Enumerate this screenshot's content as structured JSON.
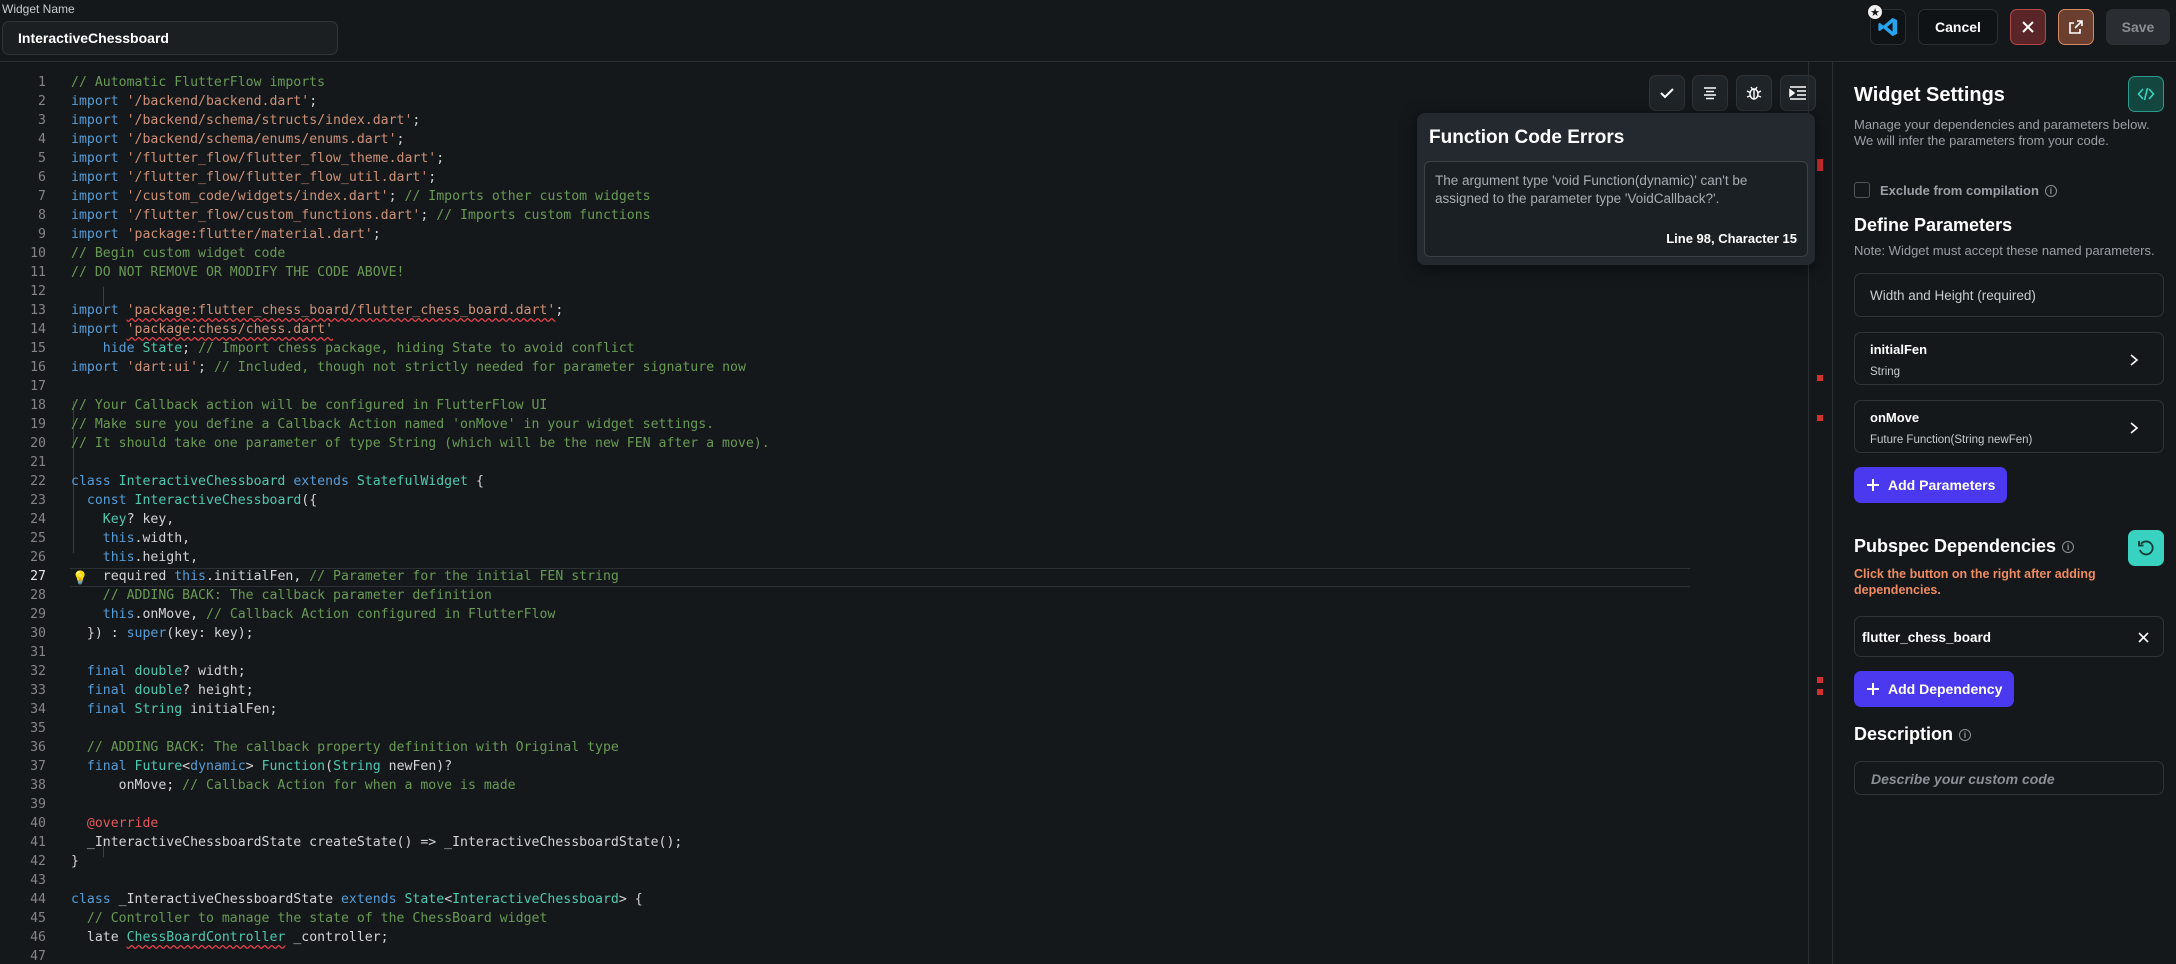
{
  "header": {
    "widget_name_label": "Widget Name",
    "widget_name_value": "InteractiveChessboard",
    "cancel_label": "Cancel",
    "save_label": "Save"
  },
  "editor": {
    "current_line": 27,
    "lines": [
      [
        [
          "c",
          "// Automatic FlutterFlow imports"
        ]
      ],
      [
        [
          "k",
          "import "
        ],
        [
          "s",
          "'/backend/backend.dart'"
        ],
        [
          "p",
          ";"
        ]
      ],
      [
        [
          "k",
          "import "
        ],
        [
          "s",
          "'/backend/schema/structs/index.dart'"
        ],
        [
          "p",
          ";"
        ]
      ],
      [
        [
          "k",
          "import "
        ],
        [
          "s",
          "'/backend/schema/enums/enums.dart'"
        ],
        [
          "p",
          ";"
        ]
      ],
      [
        [
          "k",
          "import "
        ],
        [
          "s",
          "'/flutter_flow/flutter_flow_theme.dart'"
        ],
        [
          "p",
          ";"
        ]
      ],
      [
        [
          "k",
          "import "
        ],
        [
          "s",
          "'/flutter_flow/flutter_flow_util.dart'"
        ],
        [
          "p",
          ";"
        ]
      ],
      [
        [
          "k",
          "import "
        ],
        [
          "s",
          "'/custom_code/widgets/index.dart'"
        ],
        [
          "p",
          "; "
        ],
        [
          "c",
          "// Imports other custom widgets"
        ]
      ],
      [
        [
          "k",
          "import "
        ],
        [
          "s",
          "'/flutter_flow/custom_functions.dart'"
        ],
        [
          "p",
          "; "
        ],
        [
          "c",
          "// Imports custom functions"
        ]
      ],
      [
        [
          "k",
          "import "
        ],
        [
          "s",
          "'package:flutter/material.dart'"
        ],
        [
          "p",
          ";"
        ]
      ],
      [
        [
          "c",
          "// Begin custom widget code"
        ]
      ],
      [
        [
          "c",
          "// DO NOT REMOVE OR MODIFY THE CODE ABOVE!"
        ]
      ],
      [],
      [
        [
          "k",
          "import "
        ],
        [
          "s sq",
          "'package:flutter_chess_board/flutter_chess_board.dart'"
        ],
        [
          "p",
          ";"
        ]
      ],
      [
        [
          "k",
          "import "
        ],
        [
          "s sq",
          "'package:chess/chess.dart'"
        ]
      ],
      [
        [
          "p",
          "    "
        ],
        [
          "k",
          "hide "
        ],
        [
          "t",
          "State"
        ],
        [
          "p",
          "; "
        ],
        [
          "c",
          "// Import chess package, hiding State to avoid conflict"
        ]
      ],
      [
        [
          "k",
          "import "
        ],
        [
          "s",
          "'dart:ui'"
        ],
        [
          "p",
          "; "
        ],
        [
          "c",
          "// Included, though not strictly needed for parameter signature now"
        ]
      ],
      [],
      [
        [
          "c",
          "// Your Callback action will be configured in FlutterFlow UI"
        ]
      ],
      [
        [
          "c",
          "// Make sure you define a Callback Action named 'onMove' in your widget settings."
        ]
      ],
      [
        [
          "c",
          "// It should take one parameter of type String (which will be the new FEN after a move)."
        ]
      ],
      [],
      [
        [
          "k",
          "class "
        ],
        [
          "t",
          "InteractiveChessboard "
        ],
        [
          "k",
          "extends "
        ],
        [
          "t",
          "StatefulWidget"
        ],
        [
          "p",
          " {"
        ]
      ],
      [
        [
          "p",
          "  "
        ],
        [
          "k",
          "const "
        ],
        [
          "t",
          "InteractiveChessboard"
        ],
        [
          "p",
          "({"
        ]
      ],
      [
        [
          "p",
          "    "
        ],
        [
          "t",
          "Key"
        ],
        [
          "p",
          "? key,"
        ]
      ],
      [
        [
          "p",
          "    "
        ],
        [
          "k",
          "this"
        ],
        [
          "p",
          ".width,"
        ]
      ],
      [
        [
          "p",
          "    "
        ],
        [
          "k",
          "this"
        ],
        [
          "p",
          ".height,"
        ]
      ],
      [
        [
          "p",
          "    required "
        ],
        [
          "k",
          "this"
        ],
        [
          "p",
          ".initialFen, "
        ],
        [
          "c",
          "// Parameter for the initial FEN string"
        ]
      ],
      [
        [
          "p",
          "    "
        ],
        [
          "c",
          "// ADDING BACK: The callback parameter definition"
        ]
      ],
      [
        [
          "p",
          "    "
        ],
        [
          "k",
          "this"
        ],
        [
          "p",
          ".onMove, "
        ],
        [
          "c",
          "// Callback Action configured in FlutterFlow"
        ]
      ],
      [
        [
          "p",
          "  }) : "
        ],
        [
          "k",
          "super"
        ],
        [
          "p",
          "(key: key);"
        ]
      ],
      [],
      [
        [
          "p",
          "  "
        ],
        [
          "k",
          "final "
        ],
        [
          "t",
          "double"
        ],
        [
          "p",
          "? width;"
        ]
      ],
      [
        [
          "p",
          "  "
        ],
        [
          "k",
          "final "
        ],
        [
          "t",
          "double"
        ],
        [
          "p",
          "? height;"
        ]
      ],
      [
        [
          "p",
          "  "
        ],
        [
          "k",
          "final "
        ],
        [
          "t",
          "String "
        ],
        [
          "p",
          "initialFen;"
        ]
      ],
      [],
      [
        [
          "p",
          "  "
        ],
        [
          "c",
          "// ADDING BACK: The callback property definition with Original type"
        ]
      ],
      [
        [
          "p",
          "  "
        ],
        [
          "k",
          "final "
        ],
        [
          "t",
          "Future"
        ],
        [
          "p",
          "<"
        ],
        [
          "k",
          "dynamic"
        ],
        [
          "p",
          "> "
        ],
        [
          "t",
          "Function"
        ],
        [
          "p",
          "("
        ],
        [
          "t",
          "String "
        ],
        [
          "p",
          "newFen)?"
        ]
      ],
      [
        [
          "p",
          "      onMove; "
        ],
        [
          "c",
          "// Callback Action for when a move is made"
        ]
      ],
      [],
      [
        [
          "p",
          "  "
        ],
        [
          "a",
          "@override"
        ]
      ],
      [
        [
          "p",
          "  _InteractiveChessboardState createState() => _InteractiveChessboardState();"
        ]
      ],
      [
        [
          "p",
          "}"
        ]
      ],
      [],
      [
        [
          "k",
          "class "
        ],
        [
          "p",
          "_InteractiveChessboardState "
        ],
        [
          "k",
          "extends "
        ],
        [
          "t",
          "State"
        ],
        [
          "p",
          "<"
        ],
        [
          "t",
          "InteractiveChessboard"
        ],
        [
          "p",
          "> {"
        ]
      ],
      [
        [
          "p",
          "  "
        ],
        [
          "c",
          "// Controller to manage the state of the ChessBoard widget"
        ]
      ],
      [
        [
          "p",
          "  late "
        ],
        [
          "t sq",
          "ChessBoardController"
        ],
        [
          "p",
          " _controller;"
        ]
      ],
      [
        [
          "p",
          "  "
        ]
      ]
    ]
  },
  "error_popup": {
    "title": "Function Code Errors",
    "message": "The argument type 'void Function(dynamic)' can't be assigned to the parameter type 'VoidCallback?'.",
    "location": "Line 98, Character 15"
  },
  "panel": {
    "title": "Widget Settings",
    "subtitle_line1": "Manage your dependencies and parameters below.",
    "subtitle_line2": "We will infer the parameters from your code.",
    "exclude_label": "Exclude from compilation",
    "define_params_title": "Define Parameters",
    "define_params_note": "Note: Widget must accept these named parameters.",
    "width_height_label": "Width and Height (required)",
    "params": [
      {
        "name": "initialFen",
        "type": "String"
      },
      {
        "name": "onMove",
        "type": "Future Function(String newFen)"
      }
    ],
    "add_params_label": "Add Parameters",
    "pubspec_title": "Pubspec Dependencies",
    "pubspec_note": "Click the button on the right after adding dependencies.",
    "dependency_value": "flutter_chess_board",
    "add_dependency_label": "Add Dependency",
    "description_title": "Description",
    "description_placeholder": "Describe your custom code"
  },
  "colors": {
    "accent_purple": "#4b39ef",
    "teal": "#39d2c0",
    "error_red": "#e0414a",
    "warning_orange": "#ee8b60"
  },
  "icons": [
    "vscode-icon",
    "close-icon",
    "external-link-icon",
    "check-icon",
    "format-icon",
    "bug-icon",
    "indent-icon",
    "code-icon",
    "refresh-icon",
    "chevron-right-icon",
    "plus-icon",
    "info-icon",
    "lightbulb-icon"
  ]
}
